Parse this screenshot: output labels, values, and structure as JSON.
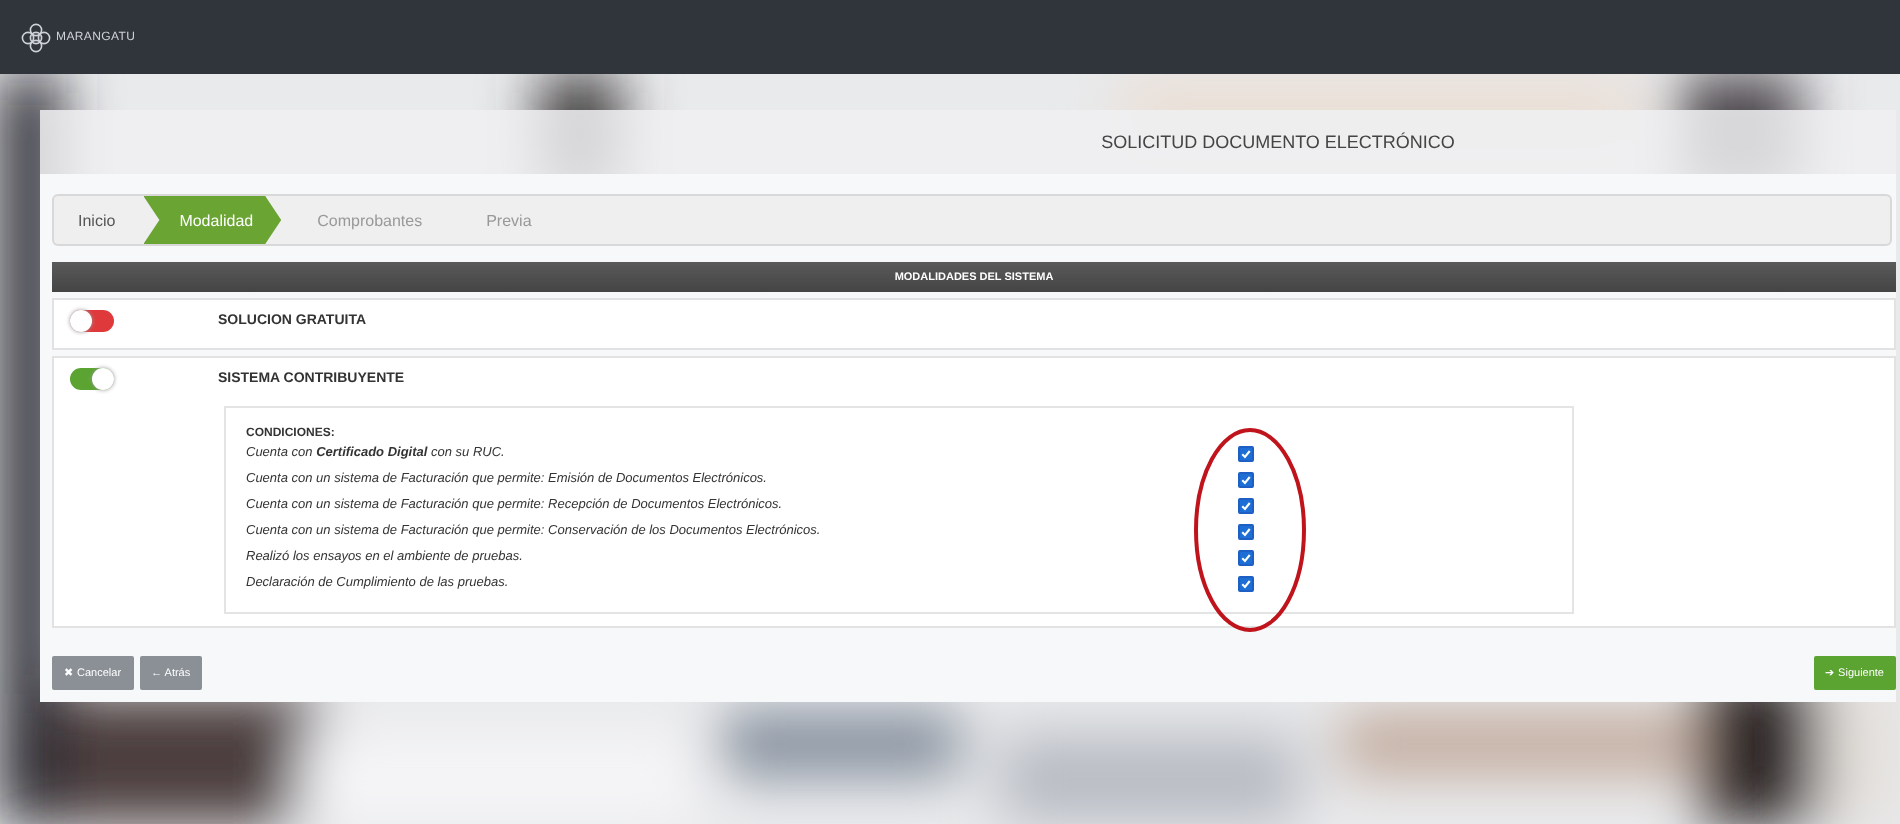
{
  "app": {
    "logo_text": "MARANGATU"
  },
  "page_title": "SOLICITUD DOCUMENTO ELECTRÓNICO",
  "steps": [
    {
      "label": "Inicio",
      "selected": false
    },
    {
      "label": "Modalidad",
      "selected": true
    },
    {
      "label": "Comprobantes",
      "selected": false
    },
    {
      "label": "Previa",
      "selected": false
    }
  ],
  "section_header": "MODALIDADES DEL SISTEMA",
  "modes": [
    {
      "label": "SOLUCION GRATUITA",
      "on": false
    },
    {
      "label": "SISTEMA CONTRIBUYENTE",
      "on": true,
      "conditions_title": "CONDICIONES:",
      "conditions": [
        {
          "text": "Cuenta con **Certificado Digital** con su RUC.",
          "checked": true
        },
        {
          "text": "Cuenta con un sistema de Facturación que permite: Emisión de Documentos Electrónicos.",
          "checked": true
        },
        {
          "text": "Cuenta con un sistema de Facturación que permite: Recepción de Documentos Electrónicos.",
          "checked": true
        },
        {
          "text": "Cuenta con un sistema de Facturación que permite: Conservación de los Documentos Electrónicos.",
          "checked": true
        },
        {
          "text": "Realizó los ensayos en el ambiente de pruebas.",
          "checked": true
        },
        {
          "text": "Declaración de Cumplimiento de las pruebas.",
          "checked": true
        }
      ]
    }
  ],
  "buttons_left": [
    {
      "icon": "✖",
      "label": "Cancelar"
    },
    {
      "icon": "←",
      "label": "Atrás"
    }
  ],
  "button_right": {
    "icon": "➔",
    "label": "Siguiente"
  }
}
